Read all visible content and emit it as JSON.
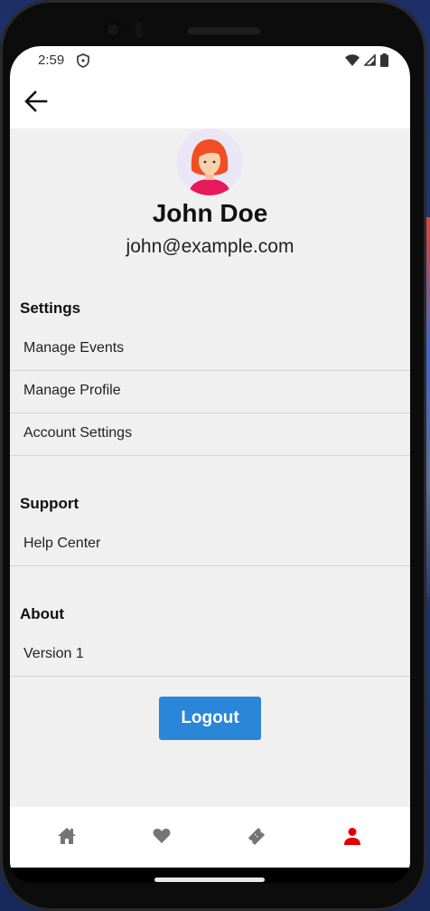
{
  "status_bar": {
    "time": "2:59",
    "icons": [
      "shield-icon",
      "wifi-icon",
      "signal-icon",
      "battery-icon"
    ]
  },
  "app_bar": {
    "back_icon": "arrow-left-icon"
  },
  "profile": {
    "name": "John Doe",
    "email": "john@example.com",
    "avatar_icon": "woman-avatar-icon"
  },
  "sections": {
    "settings": {
      "title": "Settings",
      "items": [
        "Manage Events",
        "Manage Profile",
        "Account Settings"
      ]
    },
    "support": {
      "title": "Support",
      "items": [
        "Help Center"
      ]
    },
    "about": {
      "title": "About",
      "items": [
        "Version 1"
      ]
    }
  },
  "logout_label": "Logout",
  "bottom_nav": {
    "items": [
      "home-icon",
      "heart-icon",
      "ticket-icon",
      "person-icon"
    ],
    "active": "person-icon",
    "active_color": "#e00000",
    "inactive_color": "#757575"
  },
  "colors": {
    "primary_button": "#2a86d9",
    "content_background": "#f0f0f0"
  }
}
